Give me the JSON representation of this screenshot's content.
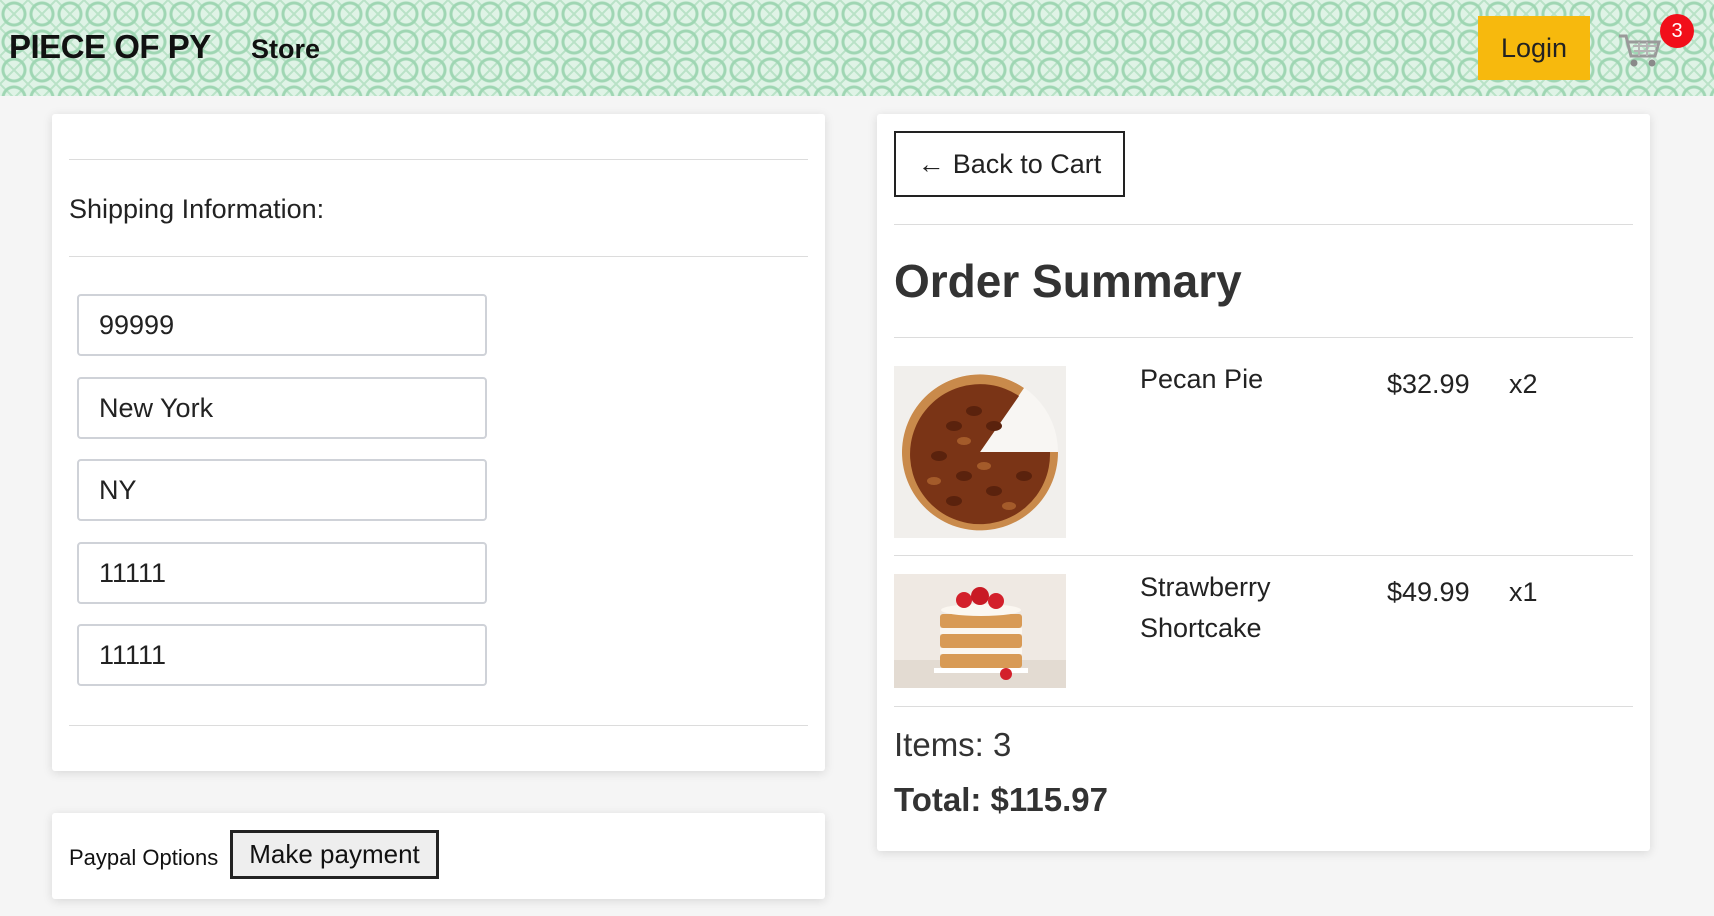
{
  "header": {
    "brand": "PIECE OF PY",
    "nav_store": "Store",
    "login_label": "Login",
    "cart_count": "3"
  },
  "shipping": {
    "title": "Shipping Information:",
    "fields": {
      "address": "99999",
      "city": "New York",
      "state": "NY",
      "zipcode": "11111",
      "country": "11111"
    }
  },
  "payment": {
    "label": "Paypal Options",
    "button_label": "Make payment"
  },
  "summary": {
    "back_label": "Back to Cart",
    "back_arrow": "←",
    "title": "Order Summary",
    "items": [
      {
        "name": "Pecan Pie",
        "price": "$32.99",
        "qty": "x2"
      },
      {
        "name": "Strawberry Shortcake",
        "price": "$49.99",
        "qty": "x1"
      }
    ],
    "items_label": "Items: 3",
    "total_label": "Total: $115.97"
  },
  "colors": {
    "login_bg": "#f7b90d",
    "badge_bg": "#f10f1a",
    "header_pattern": "#9fd6b3"
  }
}
